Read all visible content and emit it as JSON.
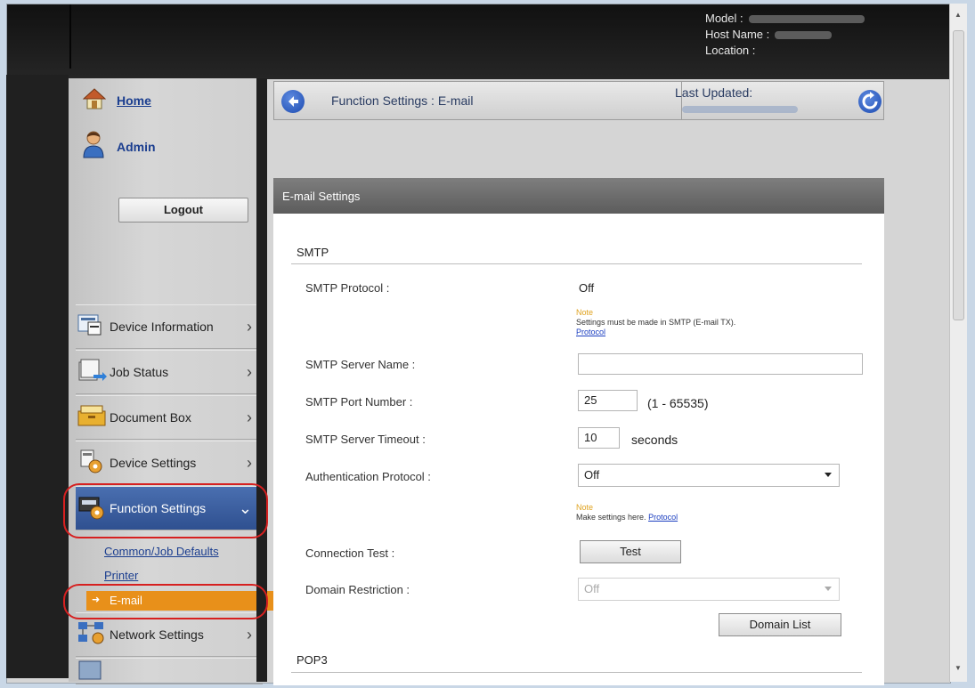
{
  "device": {
    "model_label": "Model :",
    "host_label": "Host Name :",
    "location_label": "Location :"
  },
  "sidebar": {
    "home": "Home",
    "admin": "Admin",
    "logout": "Logout",
    "nav": [
      {
        "label": "Device Information"
      },
      {
        "label": "Job Status"
      },
      {
        "label": "Document Box"
      },
      {
        "label": "Device Settings"
      },
      {
        "label": "Function Settings"
      },
      {
        "label": "Network Settings"
      }
    ],
    "sub": [
      {
        "label": "Common/Job Defaults"
      },
      {
        "label": "Printer"
      },
      {
        "label": "E-mail"
      }
    ]
  },
  "header": {
    "breadcrumb": "Function Settings : E-mail",
    "last_updated": "Last Updated:"
  },
  "panel": {
    "title": "E-mail Settings",
    "smtp_heading": "SMTP",
    "pop3_heading": "POP3",
    "fields": {
      "smtp_protocol_label": "SMTP Protocol :",
      "smtp_protocol_value": "Off",
      "note1_title": "Note",
      "note1_text": "Settings must be made in SMTP (E-mail TX).",
      "note1_link": "Protocol",
      "server_name_label": "SMTP Server Name :",
      "server_name_value": "",
      "port_label": "SMTP Port Number :",
      "port_value": "25",
      "port_range": "(1 - 65535)",
      "timeout_label": "SMTP Server Timeout :",
      "timeout_value": "10",
      "timeout_unit": "seconds",
      "auth_label": "Authentication Protocol :",
      "auth_value": "Off",
      "note2_title": "Note",
      "note2_text": "Make settings here.",
      "note2_link": "Protocol",
      "conn_test_label": "Connection Test :",
      "test_button": "Test",
      "domain_label": "Domain Restriction :",
      "domain_value": "Off",
      "domain_list_button": "Domain List"
    }
  },
  "colors": {
    "accent_blue": "#2f5090",
    "active_orange": "#e8901a",
    "highlight_red": "#d62020",
    "link_blue": "#1b3e8f"
  }
}
